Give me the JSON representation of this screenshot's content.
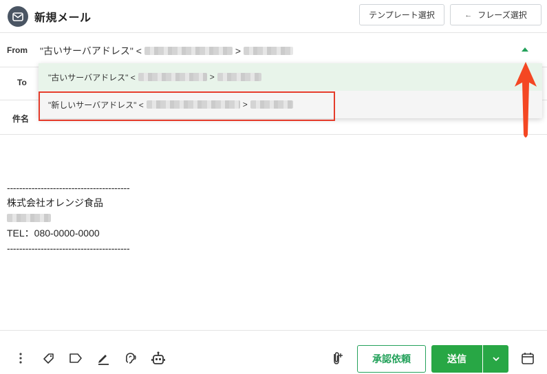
{
  "header": {
    "title": "新規メール",
    "template_button": "テンプレート選択",
    "phrase_button": "フレーズ選択",
    "phrase_arrow": "←"
  },
  "fields": {
    "from_label": "From",
    "from_value": "\"古いサーバアドレス\" <",
    "from_close": ">",
    "to_label": "To",
    "subject_label": "件名"
  },
  "from_options": [
    {
      "name": "\"古いサーバアドレス\" <",
      "close": ">"
    },
    {
      "name": "\"新しいサーバアドレス\" <",
      "close": ">"
    }
  ],
  "signature": {
    "dashes_top": "----------------------------------------",
    "company": "株式会社オレンジ食品",
    "tel": "TEL：080-0000-0000",
    "dashes_bottom": "----------------------------------------"
  },
  "toolbar": {
    "approve_label": "承認依頼",
    "send_label": "送信"
  },
  "colors": {
    "accent_green": "#28a745",
    "highlight_red": "#e53b2a",
    "selected_option_bg": "#e8f4ea"
  },
  "icons": [
    "mail-icon",
    "arrow-left-icon",
    "caret-up-icon",
    "more-vertical-icon",
    "tag-icon",
    "label-icon",
    "pen-icon",
    "ear-icon",
    "robot-icon",
    "paperclip-icon",
    "chevron-down-icon",
    "calendar-icon"
  ]
}
